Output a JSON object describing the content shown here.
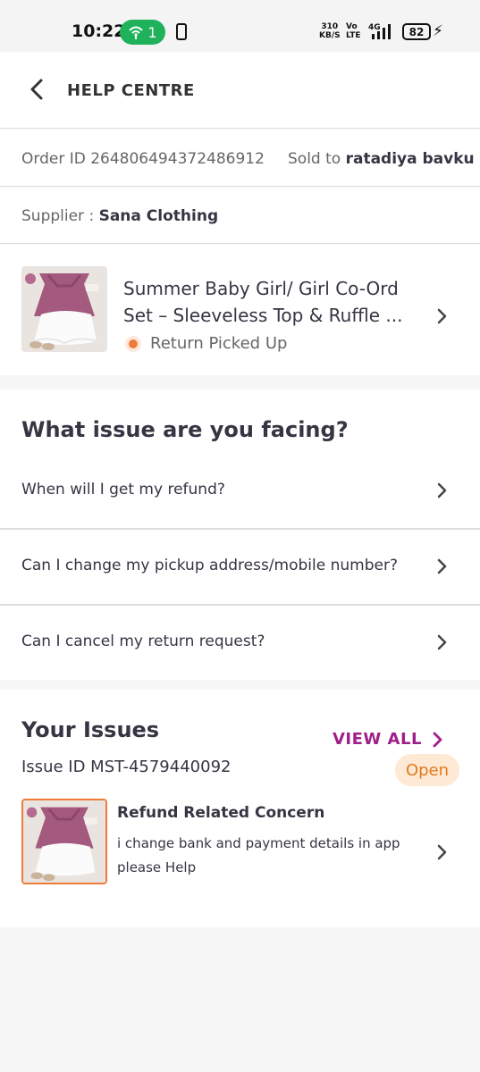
{
  "status_bar": {
    "time": "10:22",
    "hotspot_count": "1",
    "net_speed_value": "310",
    "net_speed_unit": "KB/S",
    "volte_top": "Vo",
    "volte_bottom": "LTE",
    "network_type": "4G",
    "battery_level": "82"
  },
  "header": {
    "title": "HELP CENTRE"
  },
  "order": {
    "order_id": "Order ID 264806494372486912",
    "sold_to_label": "Sold to",
    "sold_to_name": "ratadiya bavku",
    "supplier_label": "Supplier :",
    "supplier_name": "Sana Clothing"
  },
  "product": {
    "name": "Summer Baby Girl/ Girl Co-Ord Set –  Sleeveless Top & Ruffle ...",
    "status": "Return Picked Up"
  },
  "faq": {
    "heading": "What issue are you facing?",
    "questions": [
      "When will I get my refund?",
      "Can I change my pickup address/mobile number?",
      "Can I cancel my return request?"
    ]
  },
  "your_issues": {
    "heading": "Your Issues",
    "view_all": "VIEW ALL",
    "issue_id": "Issue ID MST-4579440092",
    "status": "Open",
    "title": "Refund Related Concern",
    "description": "i change bank and payment details in app please Help"
  },
  "colors": {
    "accent": "#9f2089",
    "status_orange": "#ee7b3a",
    "open_badge_bg": "#fde9d4",
    "hotspot_green": "#1fb25a"
  },
  "icons": [
    "back-arrow-icon",
    "chevron-right-icon",
    "hotspot-icon",
    "signal-icon",
    "battery-icon",
    "charging-icon"
  ]
}
